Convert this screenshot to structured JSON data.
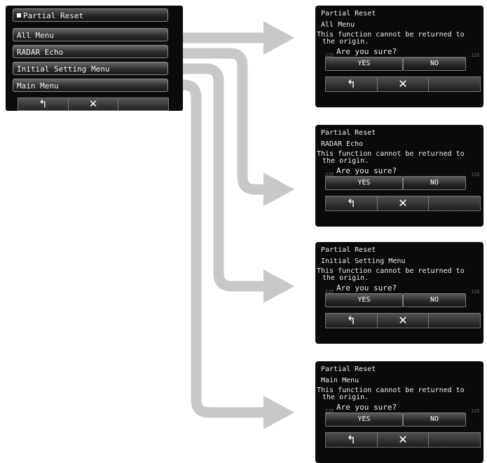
{
  "menu": {
    "title": "Partial Reset",
    "items": [
      {
        "label": "All Menu"
      },
      {
        "label": "RADAR Echo"
      },
      {
        "label": "Initial Setting Menu"
      },
      {
        "label": "Main Menu"
      }
    ],
    "footer": {
      "back_symbol": "↰",
      "close_symbol": "✕"
    }
  },
  "dialogs": [
    {
      "title": "Partial Reset",
      "target": "All Menu",
      "warning_line1": "This function cannot be returned to",
      "warning_line2": "the origin.",
      "question": "Are you sure?",
      "yes_label": "YES",
      "no_label": "NO",
      "back_symbol": "↰",
      "close_symbol": "✕",
      "dim_left": "225",
      "dim_right": "135"
    },
    {
      "title": "Partial Reset",
      "target": "RADAR Echo",
      "warning_line1": "This function cannot be returned to",
      "warning_line2": "the origin.",
      "question": "Are you sure?",
      "yes_label": "YES",
      "no_label": "NO",
      "back_symbol": "↰",
      "close_symbol": "✕",
      "dim_left": "225",
      "dim_right": "135"
    },
    {
      "title": "Partial Reset",
      "target": "Initial Setting Menu",
      "warning_line1": "This function cannot be returned to",
      "warning_line2": "the origin.",
      "question": "Are you sure?",
      "yes_label": "YES",
      "no_label": "NO",
      "back_symbol": "↰",
      "close_symbol": "✕",
      "dim_left": "225",
      "dim_right": "135"
    },
    {
      "title": "Partial Reset",
      "target": "Main Menu",
      "warning_line1": "This function cannot be returned to",
      "warning_line2": "the origin.",
      "question": "Are you sure?",
      "yes_label": "YES",
      "no_label": "NO",
      "back_symbol": "↰",
      "close_symbol": "✕",
      "dim_left": "225",
      "dim_right": "135"
    }
  ],
  "colors": {
    "arrow": "#c8c8c8",
    "screen_bg": "#0b0b0b",
    "button_border": "#8a8a8a"
  }
}
